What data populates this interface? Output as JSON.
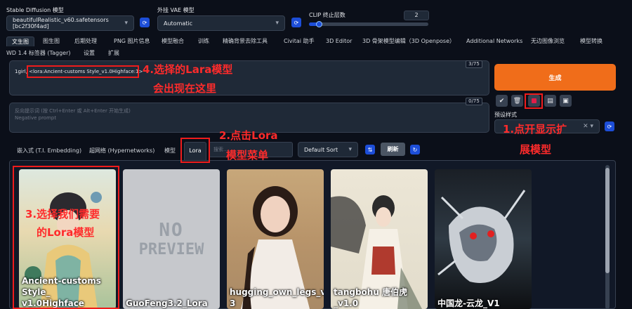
{
  "top": {
    "model_label": "Stable Diffusion 模型",
    "model_value": "beautifulRealistic_v60.safetensors [bc2f30f4ad]",
    "vae_label": "外挂 VAE 模型",
    "vae_value": "Automatic",
    "clip_label": "CLIP 终止层数",
    "clip_value": "2",
    "clip_fraction": 0.083
  },
  "tabs_row1": [
    "文生图",
    "图生图",
    "后期处理",
    "PNG 图片信息",
    "模型融合",
    "训练",
    "精确背景去除工具",
    "Civitai 助手",
    "3D Editor",
    "3D 骨架模型编辑（3D Openpose）",
    "Additional Networks",
    "无边图像浏览",
    "模型转换"
  ],
  "tabs_row2": [
    "WD 1.4 标签器 (Tagger)",
    "设置",
    "扩展"
  ],
  "prompt": {
    "text": "1girl, <lora:Ancient-customs Style_v1.0Highface:1>",
    "counter": "3/75"
  },
  "negative": {
    "placeholder_line1": "反向提示词 (按 Ctrl+Enter 或 Alt+Enter 开始生成)",
    "placeholder_line2": "Negative prompt",
    "counter": "0/75"
  },
  "generate_label": "生成",
  "toolbar_icons": [
    "check-icon",
    "trash-icon",
    "extra-networks-icon",
    "clipboard-icon",
    "save-style-icon"
  ],
  "styles_label": "预设样式",
  "network_tabs": [
    "嵌入式 (T.I. Embedding)",
    "超网络 (Hypernetworks)",
    "模型",
    "Lora"
  ],
  "search_placeholder": "搜索...",
  "sort_value": "Default Sort",
  "refresh_label": "刷新",
  "cards": [
    {
      "name": "Ancient-customs Style_ v1.0Highface"
    },
    {
      "name": "GuoFeng3.2_Lora"
    },
    {
      "name": "hugging_own_legs_v0. 3"
    },
    {
      "name": "tangbohu 唐伯虎_v1.0"
    },
    {
      "name": "中国龙-云龙_V1"
    }
  ],
  "no_preview_text_1": "NO",
  "no_preview_text_2": "PREVIEW",
  "annotations": {
    "a1_line1": "1.点开显示扩",
    "a1_line2": "展模型",
    "a2_line1": "2.点击Lora",
    "a2_line2": "模型菜单",
    "a3_line1": "3.选择我们需要",
    "a3_line2": "的Lora模型",
    "a4_line1": "4.选择的Lara模型",
    "a4_line2": "会出现在这里"
  },
  "colors": {
    "background": "#0b0f19",
    "panel": "#1f2937",
    "generate": "#f06d1a",
    "annotation": "#ff2b2b",
    "accent": "#1d4ed8"
  }
}
